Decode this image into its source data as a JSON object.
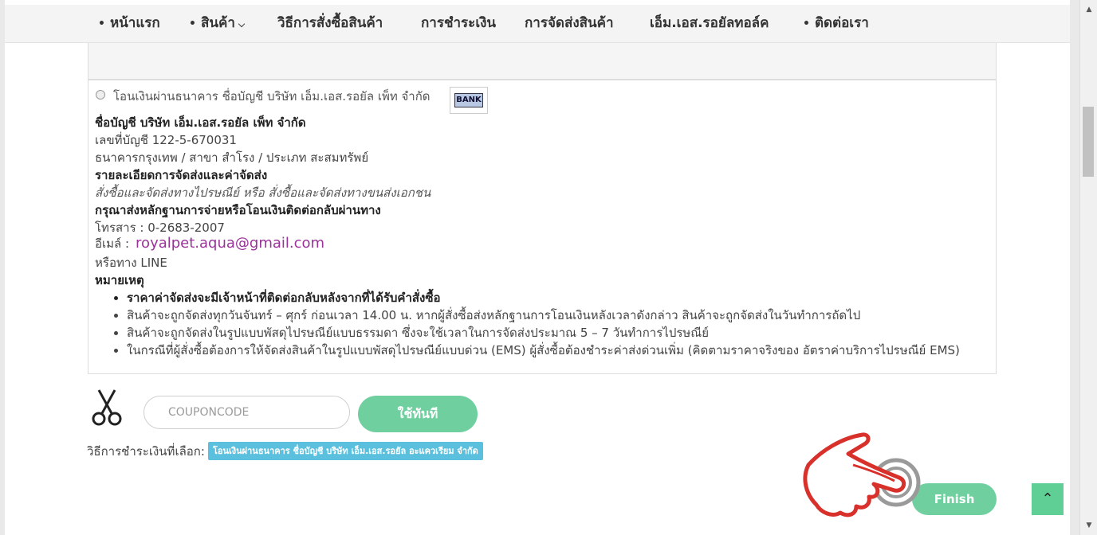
{
  "nav": {
    "items": [
      {
        "label": "หน้าแรก",
        "bullet": "•"
      },
      {
        "label": "สินค้า",
        "bullet": "•",
        "dropdown": true
      },
      {
        "label": "วิธีการสั่งซื้อสินค้า"
      },
      {
        "label": "การชำระเงิน"
      },
      {
        "label": "การจัดส่งสินค้า"
      },
      {
        "label": "เอ็ม.เอส.รอยัลทอล์ค"
      },
      {
        "label": "ติดต่อเรา",
        "bullet": "•"
      }
    ]
  },
  "payment_option": {
    "label": "โอนเงินผ่านธนาคาร ชื่อบัญชี บริษัท เอ็ม.เอส.รอยัล เพ็ท จำกัด",
    "logo_text": "BANK",
    "account_name": "ชื่อบัญชี บริษัท เอ็ม.เอส.รอยัล เพ็ท จำกัด",
    "account_number": "เลขที่บัญชี 122-5-670031",
    "bank_info": "ธนาคารกรุงเทพ / สาขา สำโรง / ประเภท สะสมทรัพย์",
    "shipping_heading": "รายละเอียดการจัดส่งและค่าจัดส่ง",
    "shipping_text": "สั่งซื้อและจัดส่งทางไปรษณีย์ หรือ สั่งซื้อและจัดส่งทางขนส่งเอกชน",
    "proof_heading": "กรุณาส่งหลักฐานการจ่ายหรือโอนเงินติดต่อกลับผ่านทาง",
    "fax": "โทรสาร : 0-2683-2007",
    "email_label": "อีเมล์ :",
    "email": "royalpet.aqua@gmail.com",
    "line": "หรือทาง LINE",
    "notes_heading": "หมายเหตุ",
    "notes": [
      "ราคาค่าจัดส่งจะมีเจ้าหน้าที่ติดต่อกลับหลังจากที่ได้รับคำสั่งซื้อ",
      "สินค้าจะถูกจัดส่งทุกวันจันทร์ – ศุกร์ ก่อนเวลา 14.00 น. หากผู้สั่งซื้อส่งหลักฐานการโอนเงินหลังเวลาดังกล่าว สินค้าจะถูกจัดส่งในวันทำการถัดไป",
      "สินค้าจะถูกจัดส่งในรูปแบบพัสดุไปรษณีย์แบบธรรมดา ซึ่งจะใช้เวลาในการจัดส่งประมาณ 5 – 7 วันทำการไปรษณีย์",
      "ในกรณีที่ผู้สั่งซื้อต้องการให้จัดส่งสินค้าในรูปแบบพัสดุไปรษณีย์แบบด่วน (EMS) ผู้สั่งซื้อต้องชำระค่าส่งด่วนเพิ่ม (คิดตามราคาจริงของ อัตราค่าบริการไปรษณีย์ EMS)"
    ]
  },
  "coupon": {
    "placeholder": "COUPONCODE",
    "value": "",
    "apply_label": "ใช้ทันที"
  },
  "selected_payment": {
    "label": "วิธีการชำระเงินที่เลือก:",
    "badge": "โอนเงินผ่านธนาคาร ชื่อบัญชี บริษัท เอ็ม.เอส.รอยัล อะแควเรียม จำกัด"
  },
  "actions": {
    "finish_label": "Finish",
    "top_icon": "chevron-up-icon"
  },
  "colors": {
    "accent_green": "#6fcf9f",
    "badge_blue": "#5bc0de",
    "email_purple": "#993399"
  }
}
